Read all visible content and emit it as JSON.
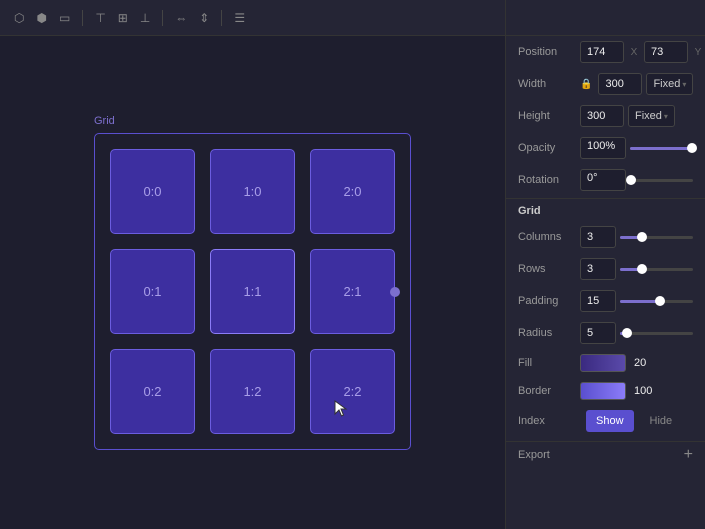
{
  "toolbar": {
    "icons": [
      "align-left",
      "align-center-h",
      "align-right",
      "align-top",
      "align-center-v",
      "align-bottom",
      "distribute-h",
      "distribute-v",
      "menu"
    ]
  },
  "canvas": {
    "grid_label": "Grid"
  },
  "grid": {
    "cells": [
      {
        "col": 0,
        "row": 0,
        "label": "0:0"
      },
      {
        "col": 1,
        "row": 0,
        "label": "1:0"
      },
      {
        "col": 2,
        "row": 0,
        "label": "2:0"
      },
      {
        "col": 0,
        "row": 1,
        "label": "0:1"
      },
      {
        "col": 1,
        "row": 1,
        "label": "1:1"
      },
      {
        "col": 2,
        "row": 1,
        "label": "2:1"
      },
      {
        "col": 0,
        "row": 2,
        "label": "0:2"
      },
      {
        "col": 1,
        "row": 2,
        "label": "1:2"
      },
      {
        "col": 2,
        "row": 2,
        "label": "2:2"
      }
    ]
  },
  "properties": {
    "position": {
      "label": "Position",
      "x_value": "174",
      "x_axis": "X",
      "y_value": "73",
      "y_axis": "Y"
    },
    "width": {
      "label": "Width",
      "value": "300",
      "dropdown": "Fixed"
    },
    "height": {
      "label": "Height",
      "value": "300",
      "dropdown": "Fixed"
    },
    "opacity": {
      "label": "Opacity",
      "value": "100%",
      "slider_pct": 100
    },
    "rotation": {
      "label": "Rotation",
      "value": "0°",
      "slider_pct": 0
    }
  },
  "grid_section": {
    "title": "Grid",
    "columns": {
      "label": "Columns",
      "value": "3",
      "slider_pct": 30
    },
    "rows": {
      "label": "Rows",
      "value": "3",
      "slider_pct": 30
    },
    "padding": {
      "label": "Padding",
      "value": "15",
      "slider_pct": 45
    },
    "radius": {
      "label": "Radius",
      "value": "5",
      "slider_pct": 15
    },
    "fill": {
      "label": "Fill",
      "color": "#4a3a9a",
      "value": "20"
    },
    "border": {
      "label": "Border",
      "color": "#6b5de0",
      "value": "100"
    },
    "index": {
      "label": "Index",
      "show_label": "Show",
      "hide_label": "Hide"
    }
  },
  "export": {
    "label": "Export",
    "plus_symbol": "+"
  }
}
